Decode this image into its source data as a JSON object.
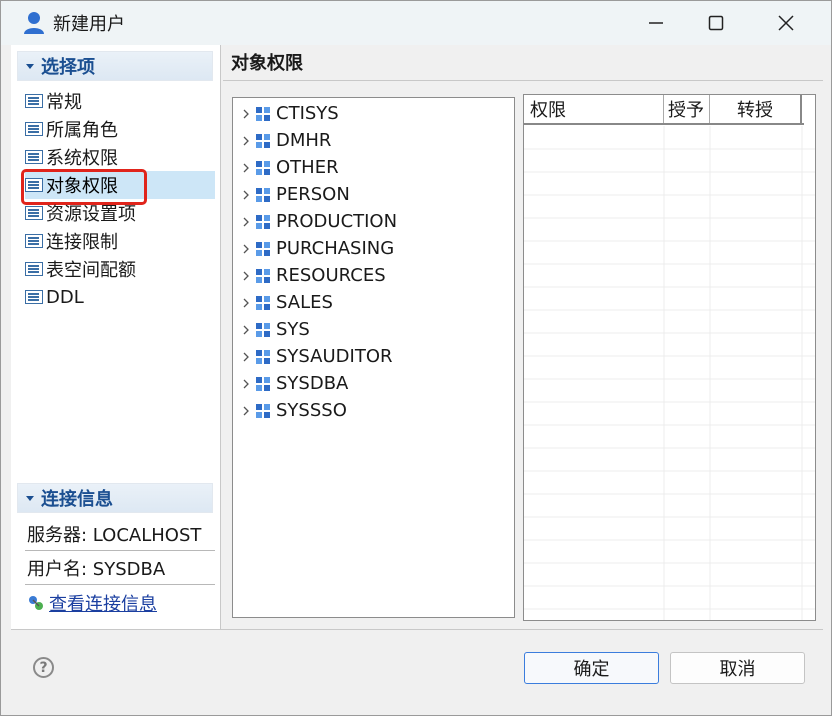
{
  "window": {
    "title": "新建用户",
    "icon": "user-icon"
  },
  "sidebar": {
    "sections": [
      {
        "label": "选择项"
      },
      {
        "label": "连接信息"
      }
    ],
    "items": [
      {
        "label": "常规"
      },
      {
        "label": "所属角色"
      },
      {
        "label": "系统权限"
      },
      {
        "label": "对象权限",
        "selected": true
      },
      {
        "label": "资源设置项"
      },
      {
        "label": "连接限制"
      },
      {
        "label": "表空间配额"
      },
      {
        "label": "DDL"
      }
    ],
    "connection": {
      "server": "服务器: LOCALHOST",
      "user": "用户名: SYSDBA",
      "link": "查看连接信息"
    }
  },
  "main": {
    "title": "对象权限",
    "tree": [
      "CTISYS",
      "DMHR",
      "OTHER",
      "PERSON",
      "PRODUCTION",
      "PURCHASING",
      "RESOURCES",
      "SALES",
      "SYS",
      "SYSAUDITOR",
      "SYSDBA",
      "SYSSSO"
    ],
    "table": {
      "columns": [
        "权限",
        "授予",
        "转授"
      ]
    }
  },
  "footer": {
    "ok": "确定",
    "cancel": "取消",
    "help": "?"
  },
  "colors": {
    "accent": "#1b4f91",
    "selection_outline": "#e0241b",
    "ok_border": "#3b7ddd"
  }
}
